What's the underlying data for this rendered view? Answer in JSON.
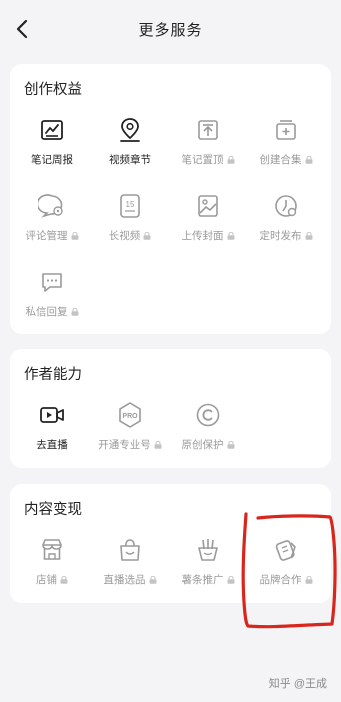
{
  "header": {
    "title": "更多服务"
  },
  "sections": [
    {
      "title": "创作权益",
      "items": [
        {
          "label": "笔记周报",
          "icon": "weekly-report-icon",
          "locked": false
        },
        {
          "label": "视频章节",
          "icon": "video-chapter-icon",
          "locked": false
        },
        {
          "label": "笔记置顶",
          "icon": "pin-top-icon",
          "locked": true
        },
        {
          "label": "创建合集",
          "icon": "create-collection-icon",
          "locked": true
        },
        {
          "label": "评论管理",
          "icon": "comment-manage-icon",
          "locked": true
        },
        {
          "label": "长视频",
          "icon": "long-video-icon",
          "locked": true,
          "badge": "15"
        },
        {
          "label": "上传封面",
          "icon": "upload-cover-icon",
          "locked": true
        },
        {
          "label": "定时发布",
          "icon": "scheduled-publish-icon",
          "locked": true
        },
        {
          "label": "私信回复",
          "icon": "message-reply-icon",
          "locked": true
        }
      ]
    },
    {
      "title": "作者能力",
      "items": [
        {
          "label": "去直播",
          "icon": "live-camera-icon",
          "locked": false
        },
        {
          "label": "开通专业号",
          "icon": "pro-account-icon",
          "locked": true,
          "badge": "PRO"
        },
        {
          "label": "原创保护",
          "icon": "copyright-icon",
          "locked": true
        }
      ]
    },
    {
      "title": "内容变现",
      "items": [
        {
          "label": "店铺",
          "icon": "store-icon",
          "locked": true
        },
        {
          "label": "直播选品",
          "icon": "shopping-bag-icon",
          "locked": true
        },
        {
          "label": "薯条推广",
          "icon": "fries-promo-icon",
          "locked": true
        },
        {
          "label": "品牌合作",
          "icon": "brand-collab-icon",
          "locked": true
        }
      ]
    }
  ],
  "watermark": "知乎 @王成",
  "colors": {
    "background": "#f4f4f6",
    "card": "#ffffff",
    "text": "#222222",
    "disabled": "#9a9a9a",
    "annotation": "#d9261c"
  }
}
